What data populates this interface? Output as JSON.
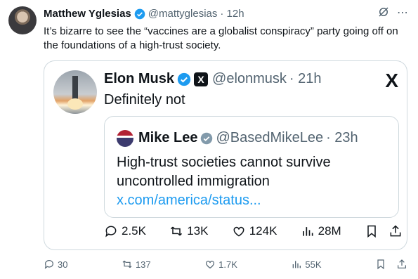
{
  "tweet": {
    "author_name": "Matthew Yglesias",
    "handle": "@mattyglesias",
    "time": "· 12h",
    "text": "It’s bizarre to see the “vaccines are a globalist conspiracy” party going off on the foundations of a high-trust society.",
    "stats": {
      "replies": "30",
      "reposts": "137",
      "likes": "1.7K",
      "views": "55K"
    }
  },
  "quote": {
    "author_name": "Elon Musk",
    "x_badge": "X",
    "handle": "@elonmusk",
    "time": "· 21h",
    "text": "Definitely not",
    "x_logo": "X",
    "stats": {
      "replies": "2.5K",
      "reposts": "13K",
      "likes": "124K",
      "views": "28M"
    }
  },
  "inner_quote": {
    "author_name": "Mike Lee",
    "handle": "@BasedMikeLee",
    "time": "· 23h",
    "text": "High-trust societies cannot survive uncontrolled immigration ",
    "link": "x.com/america/status..."
  },
  "colors": {
    "link": "#1d9bf0",
    "verified_blue": "#1d9bf0",
    "verified_gray": "#829aab",
    "muted": "#536471"
  },
  "icons": [
    "verified-badge-icon",
    "grok-icon",
    "more-icon",
    "x-logo-icon",
    "reply-icon",
    "repost-icon",
    "like-icon",
    "views-icon",
    "bookmark-icon",
    "share-icon"
  ]
}
